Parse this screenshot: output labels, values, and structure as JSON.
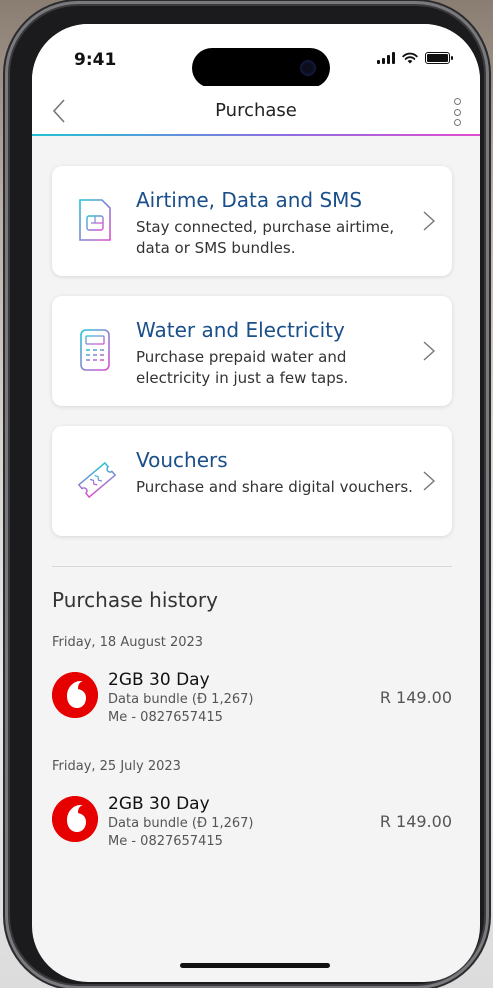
{
  "status_bar": {
    "time": "9:41"
  },
  "header": {
    "title": "Purchase"
  },
  "cards": [
    {
      "title": "Airtime, Data and SMS",
      "description": "Stay connected, purchase airtime, data or SMS bundles."
    },
    {
      "title": "Water and Electricity",
      "description": "Purchase prepaid water and electricity in just a few taps."
    },
    {
      "title": "Vouchers",
      "description": "Purchase and share digital vouchers."
    }
  ],
  "history": {
    "title": "Purchase history",
    "groups": [
      {
        "date": "Friday, 18 August 2023",
        "item": {
          "title": "2GB 30 Day",
          "type": "Data bundle (Đ 1,267)",
          "recipient": "Me - 0827657415",
          "amount": "R 149.00"
        }
      },
      {
        "date": "Friday, 25 July 2023",
        "item": {
          "title": "2GB 30 Day",
          "type": "Data bundle (Đ 1,267)",
          "recipient": "Me - 0827657415",
          "amount": "R 149.00"
        }
      }
    ]
  },
  "icons": {
    "back": "chevron-left-icon",
    "more": "vertical-dots-icon",
    "sim": "sim-card-icon",
    "meter": "electricity-meter-icon",
    "voucher": "voucher-ticket-icon",
    "brand": "vodafone-logo"
  },
  "colors": {
    "accent_gradient": [
      "#22c3d4",
      "#8b6fe0",
      "#e04ccf"
    ],
    "card_title": "#1a4f8a",
    "brand_red": "#e60000"
  }
}
